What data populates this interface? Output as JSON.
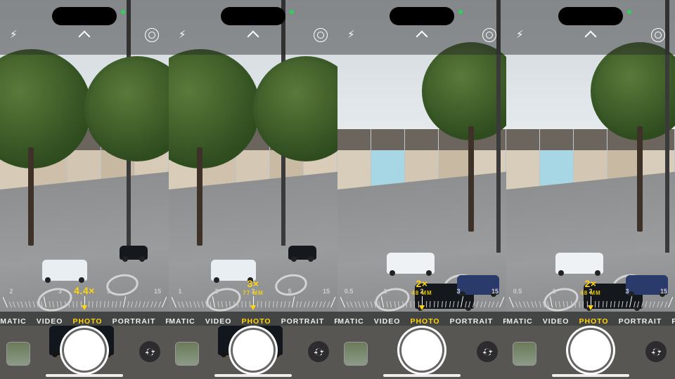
{
  "phones": [
    {
      "status": {
        "green_dot_side": "right"
      },
      "top_controls": {
        "flash": "off",
        "live_photo": "on",
        "expand": true
      },
      "zoom": {
        "readout": "4.4×",
        "focal": "",
        "dial_labels": [
          "2",
          "3",
          "5",
          "15"
        ]
      },
      "modes": {
        "items": [
          "CINEMATIC",
          "VIDEO",
          "PHOTO",
          "PORTRAIT",
          "PANO"
        ],
        "active": "PHOTO"
      },
      "shutter": "capture",
      "flip": "switch-camera",
      "thumbnail": "last-photo"
    },
    {
      "status": {
        "green_dot_side": "right"
      },
      "top_controls": {
        "flash": "off",
        "live_photo": "on",
        "expand": true
      },
      "zoom": {
        "readout": "3×",
        "focal": "77 MM",
        "dial_labels": [
          "1",
          "2",
          "3",
          "5",
          "15"
        ]
      },
      "modes": {
        "items": [
          "CINEMATIC",
          "VIDEO",
          "PHOTO",
          "PORTRAIT",
          "PANO"
        ],
        "active": "PHOTO"
      },
      "shutter": "capture",
      "flip": "switch-camera",
      "thumbnail": "last-photo"
    },
    {
      "status": {
        "green_dot_side": "right"
      },
      "top_controls": {
        "flash": "off",
        "live_photo": "on",
        "expand": true
      },
      "zoom": {
        "readout": "2×",
        "focal": "48 MM",
        "dial_labels": [
          "0.5",
          "1",
          "2",
          "3",
          "15"
        ]
      },
      "modes": {
        "items": [
          "CINEMATIC",
          "VIDEO",
          "PHOTO",
          "PORTRAIT",
          "PANO"
        ],
        "active": "PHOTO"
      },
      "shutter": "capture",
      "flip": "switch-camera",
      "thumbnail": "last-photo"
    },
    {
      "status": {
        "green_dot_side": "right"
      },
      "top_controls": {
        "flash": "off",
        "live_photo": "on",
        "expand": true
      },
      "zoom": {
        "readout": "2×",
        "focal": "48 MM",
        "dial_labels": [
          "0.5",
          "1",
          "2",
          "3",
          "15"
        ]
      },
      "modes": {
        "items": [
          "CINEMATIC",
          "VIDEO",
          "PHOTO",
          "PORTRAIT",
          "PANO"
        ],
        "active": "PHOTO"
      },
      "shutter": "capture",
      "flip": "switch-camera",
      "thumbnail": "last-photo"
    }
  ],
  "colors": {
    "accent": "#ffd60a"
  },
  "scene_palettes": [
    {
      "walls": [
        "#d7cbb8",
        "#cdbfa9",
        "#d2c6b2",
        "#c7b9a1"
      ],
      "blue_house": false
    },
    {
      "walls": [
        "#d9cdba",
        "#cfc1ab",
        "#d4c8b4",
        "#c9bba3"
      ],
      "blue_house": false
    },
    {
      "walls": [
        "#d8ccba",
        "#a7d6e4",
        "#d3c7b3",
        "#c8baa2"
      ],
      "blue_house": true
    },
    {
      "walls": [
        "#d8ccba",
        "#a7d6e4",
        "#d3c7b3",
        "#c8baa2"
      ],
      "blue_house": true
    }
  ]
}
